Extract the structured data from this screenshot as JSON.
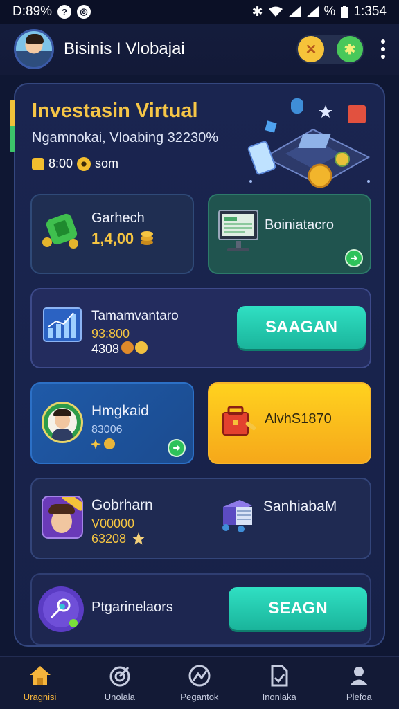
{
  "status_bar": {
    "time_left": "D:89%",
    "time_right": "1:354",
    "percent": "%"
  },
  "header": {
    "title": "Bisinis I Vlobajai"
  },
  "hero": {
    "title": "Investasin Virtual",
    "subtitle": "Ngamnokai, Vloabing 32230%",
    "balance_value": "8:00",
    "balance_unit": "som"
  },
  "cards": {
    "card1": {
      "label": "Garhech",
      "value": "1,4,00"
    },
    "card2": {
      "label": "Boiniatacro"
    },
    "card3": {
      "label": "Tamamvantaro",
      "value_1": "93:800",
      "value_2": "4308",
      "button_label": "SAAGAN"
    },
    "card4": {
      "label": "Hmgkaid",
      "value": "83006"
    },
    "card5": {
      "label": "AlvhS1870"
    },
    "card6": {
      "label": "Gobrharn",
      "value_1": "V00000",
      "value_2": "63208",
      "label_2": "SanhiabaM"
    },
    "card7": {
      "label": "Ptgarinelaors",
      "button_label": "SEAGN"
    }
  },
  "nav": {
    "items": [
      {
        "label": "Uragnisi",
        "icon": "home-icon",
        "active": true
      },
      {
        "label": "Unolala",
        "icon": "target-icon",
        "active": false
      },
      {
        "label": "Pegantok",
        "icon": "chart-icon",
        "active": false
      },
      {
        "label": "Inonlaka",
        "icon": "document-icon",
        "active": false
      },
      {
        "label": "Plefoa",
        "icon": "profile-icon",
        "active": false
      }
    ]
  },
  "colors": {
    "accent_gold": "#f6c646",
    "accent_teal": "#30e0c3",
    "background": "#0f1733",
    "active_nav": "#f4b43c"
  }
}
